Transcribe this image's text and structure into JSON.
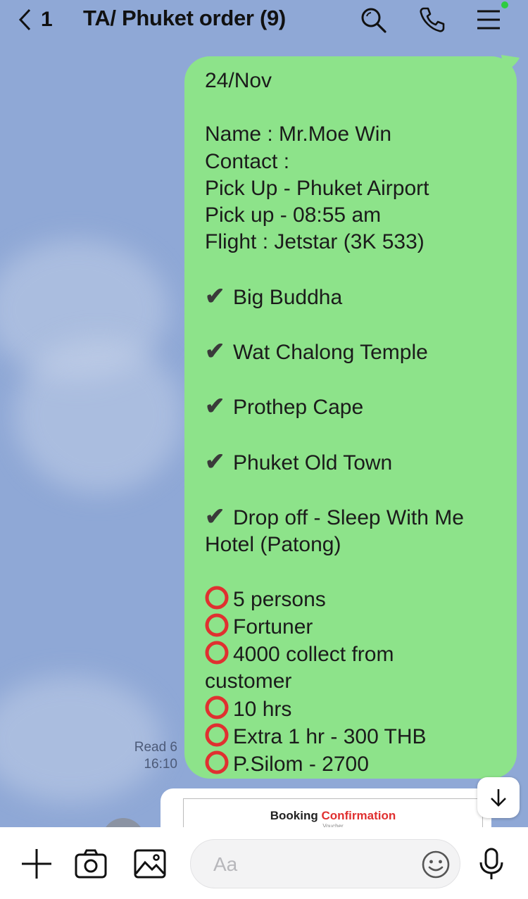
{
  "header": {
    "back_count": "1",
    "title": "TA/ Phuket order (9)",
    "icons": [
      "search-icon",
      "phone-icon",
      "menu-icon"
    ]
  },
  "message": {
    "lines": [
      {
        "type": "text",
        "text": "24/Nov"
      },
      {
        "type": "gap"
      },
      {
        "type": "text",
        "text": "Name : Mr.Moe Win"
      },
      {
        "type": "text",
        "text": "Contact :"
      },
      {
        "type": "text",
        "text": "Pick Up - Phuket Airport"
      },
      {
        "type": "text",
        "text": "Pick up - 08:55 am"
      },
      {
        "type": "text",
        "text": "Flight : Jetstar (3K 533)"
      },
      {
        "type": "gap"
      },
      {
        "type": "check",
        "text": "Big Buddha"
      },
      {
        "type": "gap"
      },
      {
        "type": "check",
        "text": "Wat Chalong Temple"
      },
      {
        "type": "gap"
      },
      {
        "type": "check",
        "text": "Prothep Cape"
      },
      {
        "type": "gap"
      },
      {
        "type": "check",
        "text": "Phuket Old Town"
      },
      {
        "type": "gap"
      },
      {
        "type": "check",
        "text": "Drop off - Sleep With Me"
      },
      {
        "type": "text",
        "text": "Hotel (Patong)"
      },
      {
        "type": "gap"
      },
      {
        "type": "ring",
        "text": "5 persons"
      },
      {
        "type": "ring",
        "text": "Fortuner"
      },
      {
        "type": "ring",
        "text": "4000 collect from"
      },
      {
        "type": "text",
        "text": "customer"
      },
      {
        "type": "ring",
        "text": "10 hrs"
      },
      {
        "type": "ring",
        "text": "Extra 1 hr - 300 THB"
      },
      {
        "type": "ring",
        "text": "P.Silom - 2700"
      }
    ],
    "read_label": "Read 6",
    "time": "16:10",
    "bubble_color": "#8de38a"
  },
  "next_card": {
    "title_prefix": "Booking",
    "title_highlight": "Confirmation",
    "subtitle": "Voucher"
  },
  "input": {
    "placeholder": "Aa",
    "value": ""
  },
  "colors": {
    "background": "#8fa8d6",
    "accent_red": "#e03030",
    "online_dot": "#2ecc40"
  }
}
